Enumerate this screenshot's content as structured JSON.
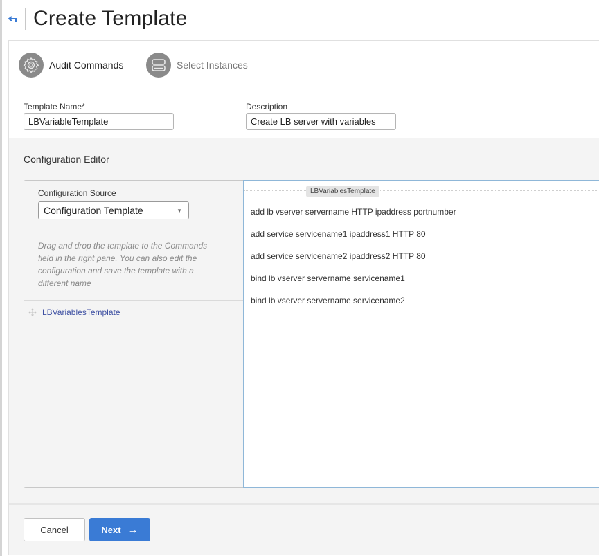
{
  "header": {
    "title": "Create Template",
    "back_icon": "back-arrow-icon"
  },
  "tabs": [
    {
      "label": "Audit Commands",
      "icon": "gear-icon",
      "active": true
    },
    {
      "label": "Select Instances",
      "icon": "server-stack-icon",
      "active": false
    }
  ],
  "form": {
    "template_name": {
      "label": "Template Name*",
      "value": "LBVariableTemplate"
    },
    "description": {
      "label": "Description",
      "value": "Create LB server with variables"
    }
  },
  "editor": {
    "title": "Configuration Editor",
    "source": {
      "label": "Configuration Source",
      "selected": "Configuration Template",
      "help_text": "Drag and drop the template to the Commands field in the right pane. You can also edit the configuration and save the template with a different name",
      "templates": [
        {
          "name": "LBVariablesTemplate",
          "icon": "drag-move-icon"
        }
      ]
    },
    "commands": {
      "tag": "LBVariablesTemplate",
      "lines": [
        "add lb vserver servername HTTP ipaddress portnumber",
        "add service servicename1 ipaddress1 HTTP 80",
        "add service servicename2 ipaddress2 HTTP 80",
        "bind lb vserver servername servicename1",
        "bind lb vserver servername servicename2"
      ]
    }
  },
  "footer": {
    "cancel_label": "Cancel",
    "next_label": "Next",
    "next_icon": "arrow-right-icon"
  },
  "colors": {
    "primary": "#3a7bd5",
    "link": "#3f51a3",
    "focus_border": "#8fb7d8"
  }
}
